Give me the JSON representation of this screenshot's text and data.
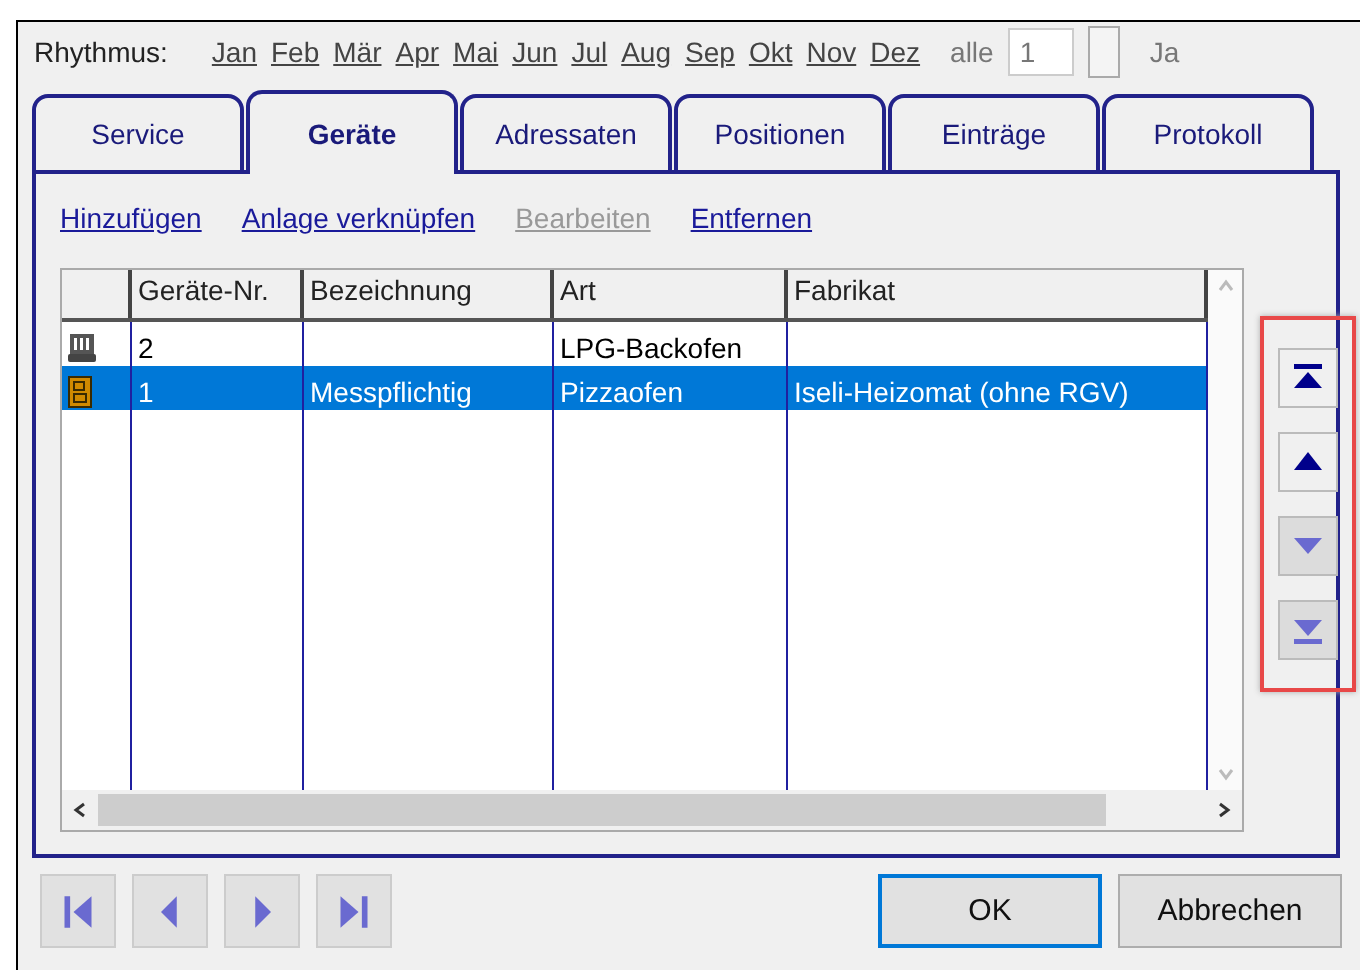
{
  "rhythm": {
    "label": "Rhythmus:",
    "months": [
      "Jan",
      "Feb",
      "Mär",
      "Apr",
      "Mai",
      "Jun",
      "Jul",
      "Aug",
      "Sep",
      "Okt",
      "Nov",
      "Dez"
    ],
    "interval_label": "alle",
    "interval_value": "1",
    "unit": "Ja"
  },
  "tabs": [
    {
      "label": "Service",
      "selected": false
    },
    {
      "label": "Geräte",
      "selected": true
    },
    {
      "label": "Adressaten",
      "selected": false
    },
    {
      "label": "Positionen",
      "selected": false
    },
    {
      "label": "Einträge",
      "selected": false
    },
    {
      "label": "Protokoll",
      "selected": false
    }
  ],
  "actions": [
    {
      "label": "Hinzufügen",
      "disabled": false
    },
    {
      "label": "Anlage verknüpfen",
      "disabled": false
    },
    {
      "label": "Bearbeiten",
      "disabled": true
    },
    {
      "label": "Entfernen",
      "disabled": false
    }
  ],
  "table": {
    "columns": [
      "Geräte-Nr.",
      "Bezeichnung",
      "Art",
      "Fabrikat"
    ],
    "rows": [
      {
        "kind": "oven",
        "selected": false,
        "cells": [
          "2",
          "",
          "LPG-Backofen",
          ""
        ]
      },
      {
        "kind": "cabinet",
        "selected": true,
        "cells": [
          "1",
          "Messpflichtig",
          "Pizzaofen",
          "Iseli-Heizomat (ohne RGV)"
        ]
      }
    ]
  },
  "move_buttons": [
    {
      "kind": "first",
      "disabled": false
    },
    {
      "kind": "up",
      "disabled": false
    },
    {
      "kind": "down",
      "disabled": true
    },
    {
      "kind": "last",
      "disabled": true
    }
  ],
  "nav_buttons": [
    {
      "kind": "first",
      "disabled": true
    },
    {
      "kind": "prev",
      "disabled": true
    },
    {
      "kind": "next",
      "disabled": true
    },
    {
      "kind": "last",
      "disabled": true
    }
  ],
  "buttons": [
    {
      "label": "OK",
      "default": true
    },
    {
      "label": "Abbrechen",
      "default": false
    }
  ]
}
